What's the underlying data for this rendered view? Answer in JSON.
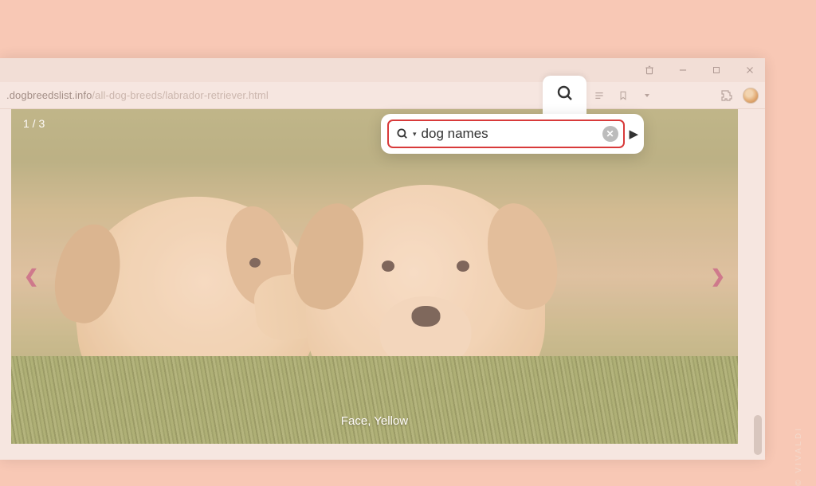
{
  "window": {
    "controls": {
      "trash": "trash",
      "min": "minimize",
      "max": "maximize",
      "close": "close"
    }
  },
  "toolbar": {
    "url_host": ".dogbreedslist.info",
    "url_path": "/all-dog-breeds/labrador-retriever.html"
  },
  "gallery": {
    "counter": "1 / 3",
    "caption": "Face, Yellow"
  },
  "search": {
    "value": "dog names"
  },
  "branding": {
    "vivaldi": "© VIVALDI"
  }
}
